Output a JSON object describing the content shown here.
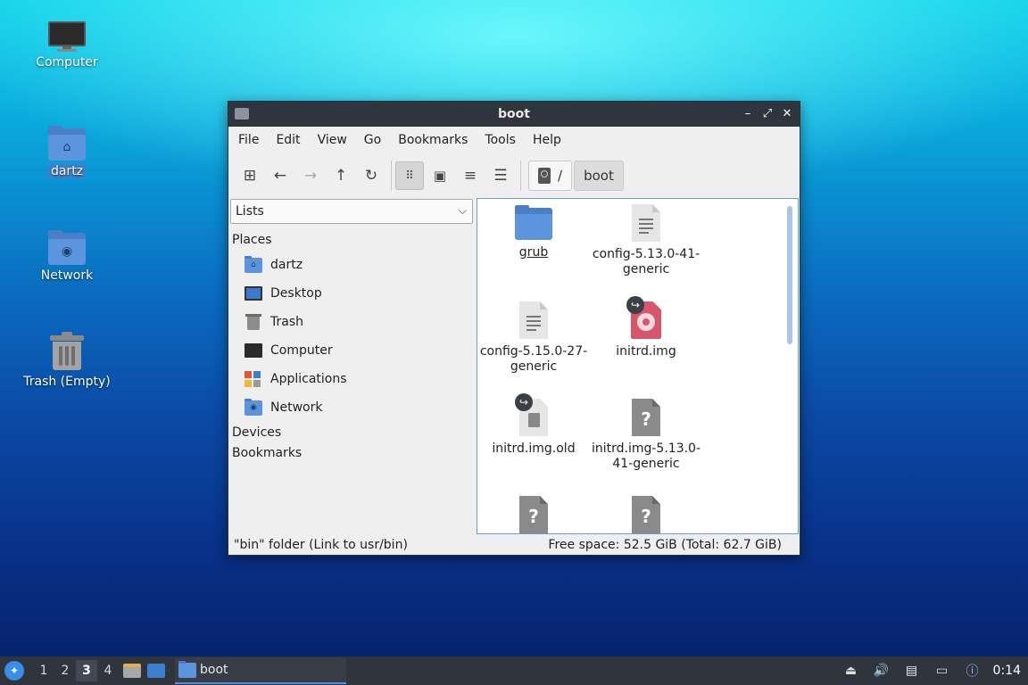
{
  "desktop": {
    "icons": [
      {
        "label": "Computer"
      },
      {
        "label": "dartz"
      },
      {
        "label": "Network"
      },
      {
        "label": "Trash (Empty)"
      }
    ]
  },
  "window": {
    "title": "boot",
    "controls": {
      "minimize": "–",
      "maximize": "⤢",
      "close": "✕"
    },
    "menu": [
      "File",
      "Edit",
      "Go",
      "Bookmarks",
      "Tools",
      "Help"
    ],
    "path": {
      "root": "/",
      "current": "boot"
    },
    "side_panel": {
      "mode": "Lists",
      "places_heading": "Places",
      "places": [
        "dartz",
        "Desktop",
        "Trash",
        "Computer",
        "Applications",
        "Network"
      ],
      "devices_heading": "Devices",
      "bookmarks_heading": "Bookmarks"
    },
    "files": [
      {
        "name": "grub",
        "type": "folder"
      },
      {
        "name": "config-5.13.0-41-generic",
        "type": "text"
      },
      {
        "name": "config-5.15.0-27-generic",
        "type": "text"
      },
      {
        "name": "initrd.img",
        "type": "disc-link"
      },
      {
        "name": "initrd.img.old",
        "type": "bin-link"
      },
      {
        "name": "initrd.img-5.13.0-41-generic",
        "type": "unknown"
      },
      {
        "name": "",
        "type": "unknown"
      },
      {
        "name": "",
        "type": "unknown"
      }
    ],
    "status": {
      "left": "\"bin\" folder (Link to usr/bin)",
      "right": "Free space: 52.5 GiB (Total: 62.7 GiB)"
    }
  },
  "taskbar": {
    "workspaces": [
      "1",
      "2",
      "3",
      "4"
    ],
    "active_workspace": "3",
    "task_label": "boot",
    "clock": "0:14"
  },
  "colors": {
    "accent": "#4a8fe0",
    "titlebar": "#2f343d",
    "folder": "#5b95dd"
  }
}
